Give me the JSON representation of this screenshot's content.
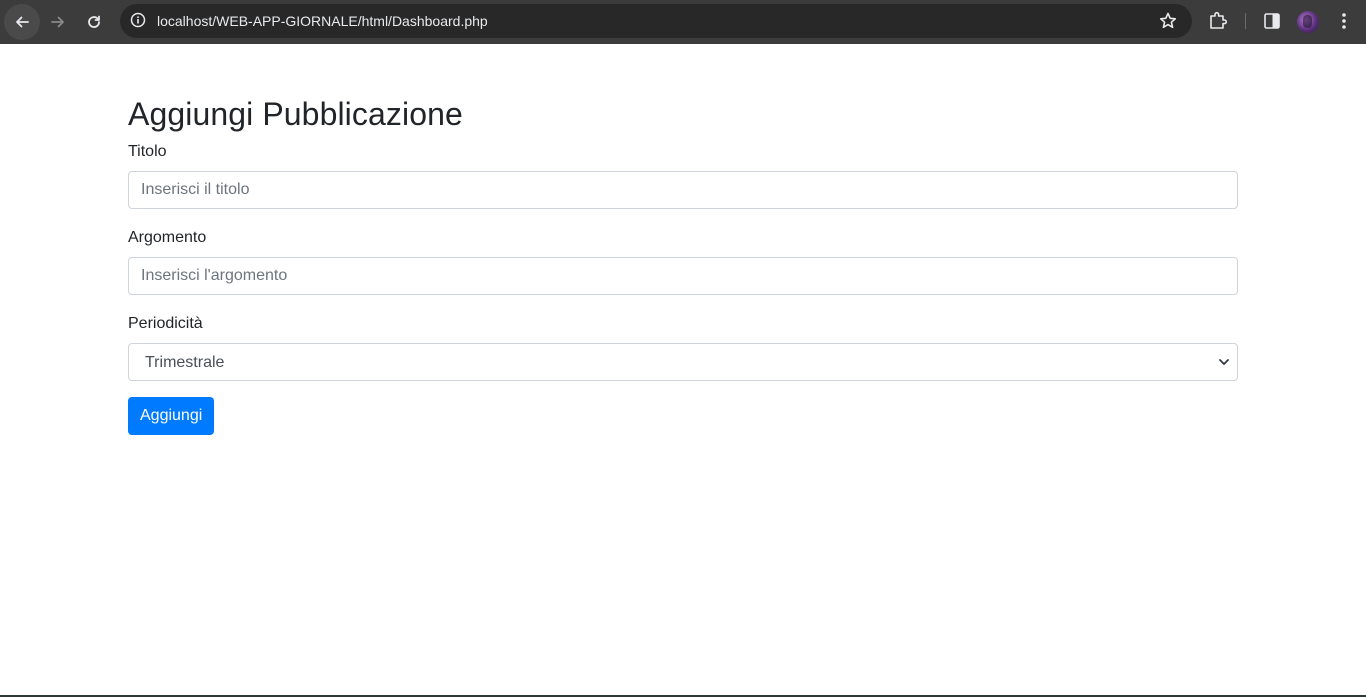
{
  "browser": {
    "url": "localhost/WEB-APP-GIORNALE/html/Dashboard.php",
    "icons": {
      "back": "arrow-left-icon",
      "forward": "arrow-right-icon",
      "reload": "reload-icon",
      "site_info": "info-icon",
      "bookmark": "star-icon",
      "extensions": "puzzle-icon",
      "side_panel": "side-panel-icon",
      "profile": "avatar",
      "menu": "kebab-menu-icon"
    }
  },
  "form": {
    "title": "Aggiungi Pubblicazione",
    "titolo": {
      "label": "Titolo",
      "placeholder": "Inserisci il titolo",
      "value": ""
    },
    "argomento": {
      "label": "Argomento",
      "placeholder": "Inserisci l'argomento",
      "value": ""
    },
    "periodicita": {
      "label": "Periodicità",
      "selected": "Trimestrale"
    },
    "submit_label": "Aggiungi"
  },
  "colors": {
    "chrome_bg": "#3c3c3c",
    "omnibox_bg": "#282828",
    "primary": "#007bff",
    "text": "#212529",
    "input_border": "#ced4da"
  }
}
